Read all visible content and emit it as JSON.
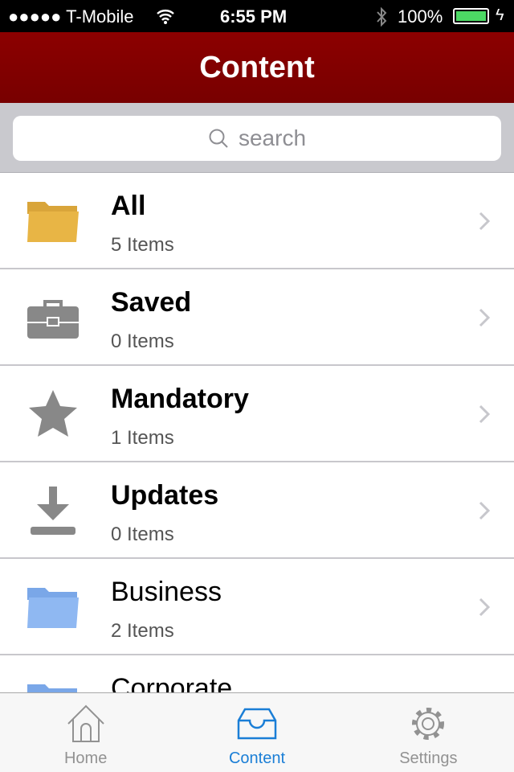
{
  "status": {
    "carrier": "●●●●● T-Mobile",
    "time": "6:55 PM",
    "battery": "100%"
  },
  "header": {
    "title": "Content"
  },
  "search": {
    "placeholder": "search"
  },
  "items": [
    {
      "title": "All",
      "subtitle": "5 Items",
      "icon": "folder-yellow-icon",
      "bold": true
    },
    {
      "title": "Saved",
      "subtitle": "0 Items",
      "icon": "briefcase-icon",
      "bold": true
    },
    {
      "title": "Mandatory",
      "subtitle": "1 Items",
      "icon": "star-icon",
      "bold": true
    },
    {
      "title": "Updates",
      "subtitle": "0 Items",
      "icon": "download-icon",
      "bold": true
    },
    {
      "title": "Business",
      "subtitle": "2 Items",
      "icon": "folder-blue-icon",
      "bold": false
    },
    {
      "title": "Corporate",
      "subtitle": "",
      "icon": "folder-blue-icon",
      "bold": false
    }
  ],
  "tabs": [
    {
      "label": "Home",
      "icon": "home-icon"
    },
    {
      "label": "Content",
      "icon": "inbox-icon",
      "active": true
    },
    {
      "label": "Settings",
      "icon": "gear-icon"
    }
  ],
  "colors": {
    "header": "#8c0000",
    "accent": "#1a7ed6",
    "folder_yellow": "#e8b545",
    "folder_blue": "#8fb8f2",
    "battery": "#4cd964"
  }
}
